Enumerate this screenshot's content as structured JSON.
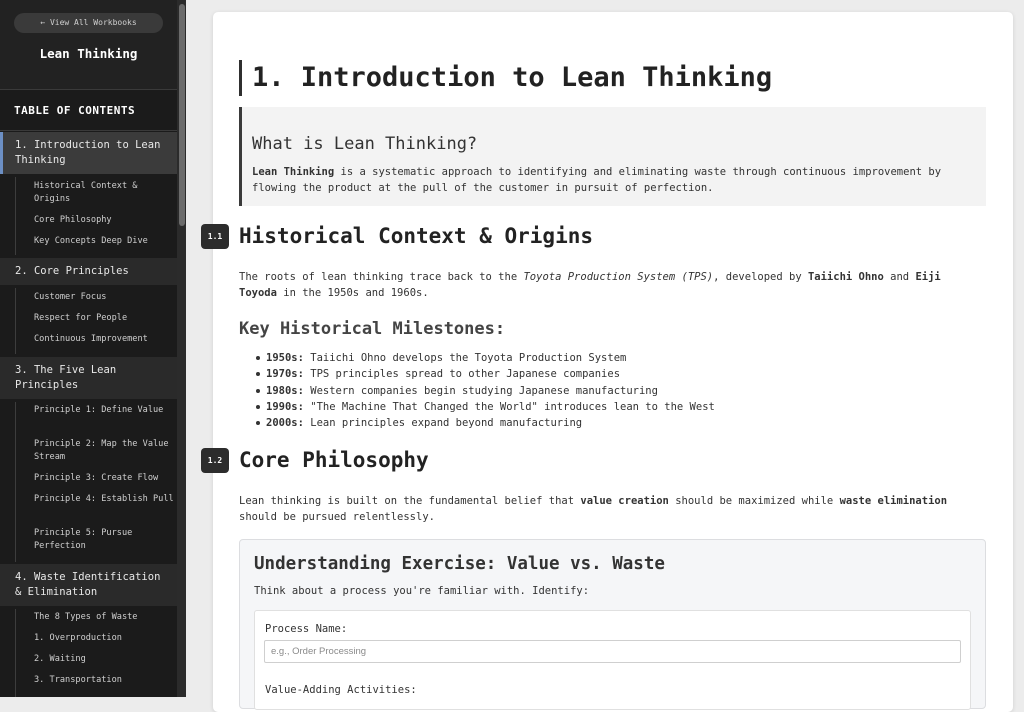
{
  "sidebar": {
    "back_label": "← View All Workbooks",
    "workbook_title": "Lean Thinking",
    "toc_title": "TABLE OF CONTENTS",
    "sections": [
      {
        "label": "1. Introduction to Lean Thinking",
        "subs": [
          "Historical Context & Origins",
          "Core Philosophy",
          "Key Concepts Deep Dive"
        ]
      },
      {
        "label": "2. Core Principles",
        "subs": [
          "Customer Focus",
          "Respect for People",
          "Continuous Improvement"
        ]
      },
      {
        "label": "3. The Five Lean Principles",
        "subs": [
          "Principle 1: Define Value",
          "Principle 2: Map the Value Stream",
          "Principle 3: Create Flow",
          "Principle 4: Establish Pull",
          "Principle 5: Pursue Perfection"
        ]
      },
      {
        "label": "4. Waste Identification & Elimination",
        "subs": [
          "The 8 Types of Waste",
          "1. Overproduction",
          "2. Waiting",
          "3. Transportation"
        ]
      }
    ]
  },
  "main": {
    "title": "1. Introduction to Lean Thinking",
    "callout": {
      "heading": "What is Lean Thinking?",
      "term": "Lean Thinking",
      "text": " is a systematic approach to identifying and eliminating waste through continuous improvement by flowing the product at the pull of the customer in pursuit of perfection."
    },
    "s11": {
      "badge": "1.1",
      "heading": "Historical Context & Origins",
      "p_a": "The roots of lean thinking trace back to the ",
      "p_tps": "Toyota Production System (TPS)",
      "p_b": ", developed by ",
      "p_ohno": "Taiichi Ohno",
      "p_and": " and ",
      "p_toyoda": "Eiji Toyoda",
      "p_c": " in the 1950s and 1960s.",
      "milestones_heading": "Key Historical Milestones:",
      "milestones": [
        {
          "year": "1950s:",
          "text": " Taiichi Ohno develops the Toyota Production System"
        },
        {
          "year": "1970s:",
          "text": " TPS principles spread to other Japanese companies"
        },
        {
          "year": "1980s:",
          "text": " Western companies begin studying Japanese manufacturing"
        },
        {
          "year": "1990s:",
          "text": " \"The Machine That Changed the World\" introduces lean to the West"
        },
        {
          "year": "2000s:",
          "text": " Lean principles expand beyond manufacturing"
        }
      ]
    },
    "s12": {
      "badge": "1.2",
      "heading": "Core Philosophy",
      "p_a": "Lean thinking is built on the fundamental belief that ",
      "p_value": "value creation",
      "p_b": " should be maximized while ",
      "p_waste": "waste elimination",
      "p_c": " should be pursued relentlessly."
    },
    "exercise": {
      "heading": "Understanding Exercise: Value vs. Waste",
      "intro": "Think about a process you're familiar with. Identify:",
      "process_label": "Process Name:",
      "process_placeholder": "e.g., Order Processing",
      "process_value": "",
      "value_label": "Value-Adding Activities:"
    }
  }
}
